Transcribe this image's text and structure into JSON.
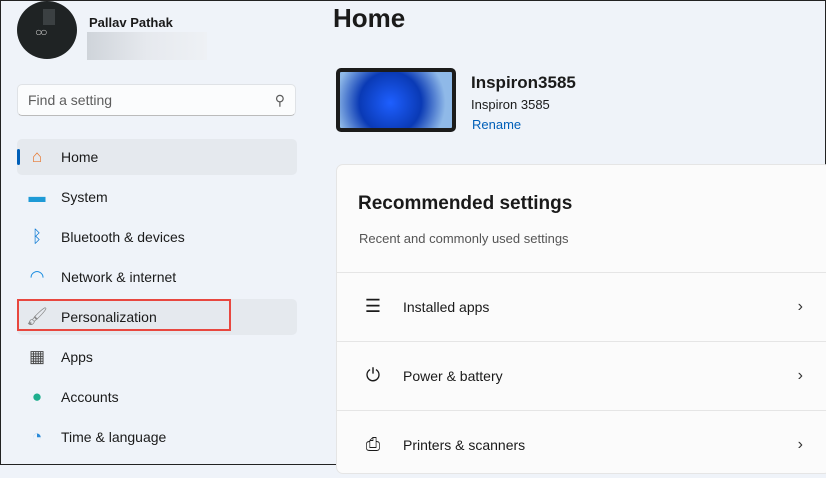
{
  "user": {
    "name": "Pallav Pathak"
  },
  "search": {
    "placeholder": "Find a setting"
  },
  "nav": [
    {
      "label": "Home",
      "icon": "home-icon",
      "glyph": "⌂",
      "color": "#e8772e"
    },
    {
      "label": "System",
      "icon": "system-icon",
      "glyph": "▬",
      "color": "#1e9ad6"
    },
    {
      "label": "Bluetooth & devices",
      "icon": "bluetooth-icon",
      "glyph": "ᛒ",
      "color": "#0a78d4"
    },
    {
      "label": "Network & internet",
      "icon": "wifi-icon",
      "glyph": "◠",
      "color": "#1e8ee0"
    },
    {
      "label": "Personalization",
      "icon": "brush-icon",
      "glyph": "🖌",
      "color": "#888"
    },
    {
      "label": "Apps",
      "icon": "apps-icon",
      "glyph": "▦",
      "color": "#444"
    },
    {
      "label": "Accounts",
      "icon": "accounts-icon",
      "glyph": "●",
      "color": "#1fae8e"
    },
    {
      "label": "Time & language",
      "icon": "time-language-icon",
      "glyph": "◔",
      "color": "#2a8ad8"
    }
  ],
  "main": {
    "title": "Home",
    "device": {
      "name": "Inspiron3585",
      "model": "Inspiron 3585",
      "rename": "Rename"
    },
    "recommended": {
      "title": "Recommended settings",
      "subtitle": "Recent and commonly used settings",
      "items": [
        {
          "label": "Installed apps",
          "icon": "installed-apps-icon",
          "glyph": "☰"
        },
        {
          "label": "Power & battery",
          "icon": "power-icon",
          "glyph": "⏻"
        },
        {
          "label": "Printers & scanners",
          "icon": "printer-icon",
          "glyph": "⎙"
        }
      ]
    }
  }
}
